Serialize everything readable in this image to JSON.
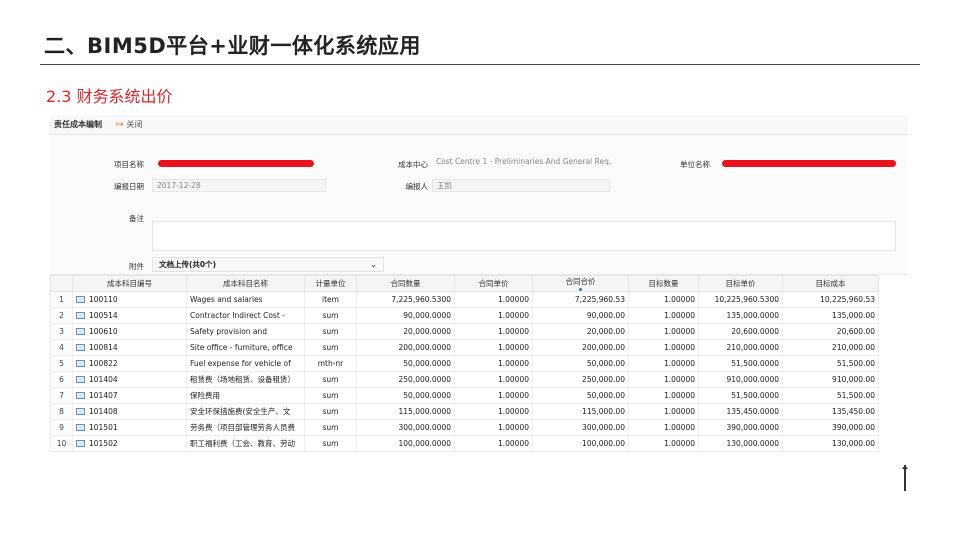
{
  "slide": {
    "title": "二、BIM5D平台+业财一体化系统应用",
    "section": "2.3 财务系统出价"
  },
  "toolbar": {
    "title": "责任成本编制",
    "close_label": "关闭",
    "close_icon": "exit-icon"
  },
  "form": {
    "project_label": "项目名称",
    "cost_center_label": "成本中心",
    "cost_center_value": "Cost Centre 1 - Preliminaries And General Req.",
    "unit_label": "单位名称",
    "date_label": "编报日期",
    "date_value": "2017-12-28",
    "reporter_label": "编报人",
    "reporter_value": "王凯",
    "remarks_label": "备注",
    "attachment_label": "附件",
    "attachment_value": "文档上传(共0个)"
  },
  "table": {
    "headers": [
      "",
      "成本科目编号",
      "成本科目名称",
      "计量单位",
      "合同数量",
      "合同单价",
      "合同合价",
      "目标数量",
      "目标单价",
      "目标成本"
    ],
    "rows": [
      [
        "1",
        "100110",
        "Wages and salaries",
        "item",
        "7,225,960.5300",
        "1.00000",
        "7,225,960.53",
        "1.00000",
        "10,225,960.5300",
        "10,225,960.53"
      ],
      [
        "2",
        "100514",
        "Contractor Indirect Cost -",
        "sum",
        "90,000.0000",
        "1.00000",
        "90,000.00",
        "1.00000",
        "135,000.0000",
        "135,000.00"
      ],
      [
        "3",
        "100610",
        "Safety provision and",
        "sum",
        "20,000.0000",
        "1.00000",
        "20,000.00",
        "1.00000",
        "20,600.0000",
        "20,600.00"
      ],
      [
        "4",
        "100814",
        "Site office - furniture, office",
        "sum",
        "200,000.0000",
        "1.00000",
        "200,000.00",
        "1.00000",
        "210,000.0000",
        "210,000.00"
      ],
      [
        "5",
        "100822",
        "Fuel expense for vehicle of",
        "mth-nr",
        "50,000.0000",
        "1.00000",
        "50,000.00",
        "1.00000",
        "51,500.0000",
        "51,500.00"
      ],
      [
        "6",
        "101404",
        "租赁费（场地租赁、设备租赁）",
        "sum",
        "250,000.0000",
        "1.00000",
        "250,000.00",
        "1.00000",
        "910,000.0000",
        "910,000.00"
      ],
      [
        "7",
        "101407",
        "保险费用",
        "sum",
        "50,000.0000",
        "1.00000",
        "50,000.00",
        "1.00000",
        "51,500.0000",
        "51,500.00"
      ],
      [
        "8",
        "101408",
        "安全环保措施费(安全生产、文",
        "sum",
        "115,000.0000",
        "1.00000",
        "115,000.00",
        "1.00000",
        "135,450.0000",
        "135,450.00"
      ],
      [
        "9",
        "101501",
        "劳务费（项目部管理劳务人员费",
        "sum",
        "300,000.0000",
        "1.00000",
        "300,000.00",
        "1.00000",
        "390,000.0000",
        "390,000.00"
      ],
      [
        "10",
        "101502",
        "职工福利费（工会、教育、劳动",
        "sum",
        "100,000.0000",
        "1.00000",
        "100,000.00",
        "1.00000",
        "130,000.0000",
        "130,000.00"
      ]
    ]
  },
  "colors": {
    "accent_red": "#d9262b",
    "redaction": "#e8131b"
  }
}
